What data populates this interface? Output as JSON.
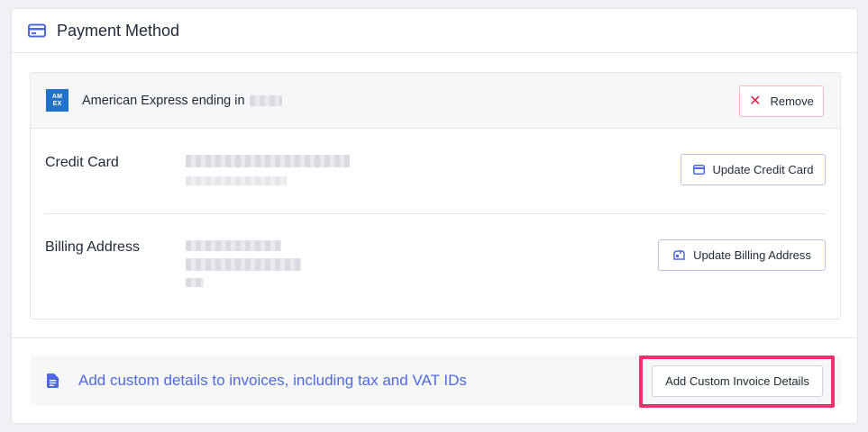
{
  "panel": {
    "title": "Payment Method",
    "icon": "credit-card-icon"
  },
  "card": {
    "brand_logo_text": [
      "AM",
      "EX"
    ],
    "description": "American Express ending in",
    "remove_label": "Remove"
  },
  "credit_card": {
    "label": "Credit Card",
    "update_label": "Update Credit Card"
  },
  "billing": {
    "label": "Billing Address",
    "update_label": "Update Billing Address"
  },
  "invoice": {
    "message": "Add custom details to invoices, including tax and VAT IDs",
    "button_label": "Add Custom Invoice Details"
  },
  "colors": {
    "accent": "#4f6ae0",
    "danger": "#e11d48",
    "highlight": "#f0306b",
    "amex": "#1f72cd"
  }
}
